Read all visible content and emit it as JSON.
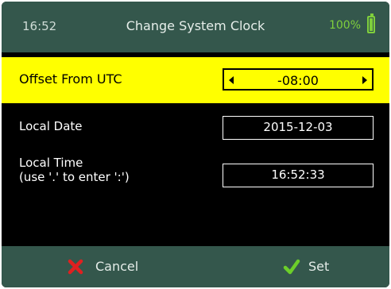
{
  "header": {
    "time": "16:52",
    "title": "Change System Clock",
    "battery": "100%"
  },
  "settings": {
    "offset": {
      "label": "Offset From UTC",
      "value": "-08:00"
    },
    "date": {
      "label": "Local Date",
      "value": "2015-12-03"
    },
    "time": {
      "label_line1": "Local Time",
      "label_line2": "(use '.' to enter ':')",
      "value": "16:52:33"
    }
  },
  "footer": {
    "cancel_label": "Cancel",
    "set_label": "Set"
  },
  "colors": {
    "bar": "#34574c",
    "highlight": "#ffff00",
    "battery": "#7fcf3c",
    "cancel_icon": "#e02020",
    "check_icon": "#6ccf2a"
  },
  "icons": {
    "battery": "battery-full-icon",
    "cancel": "x-icon",
    "set": "checkmark-icon"
  }
}
